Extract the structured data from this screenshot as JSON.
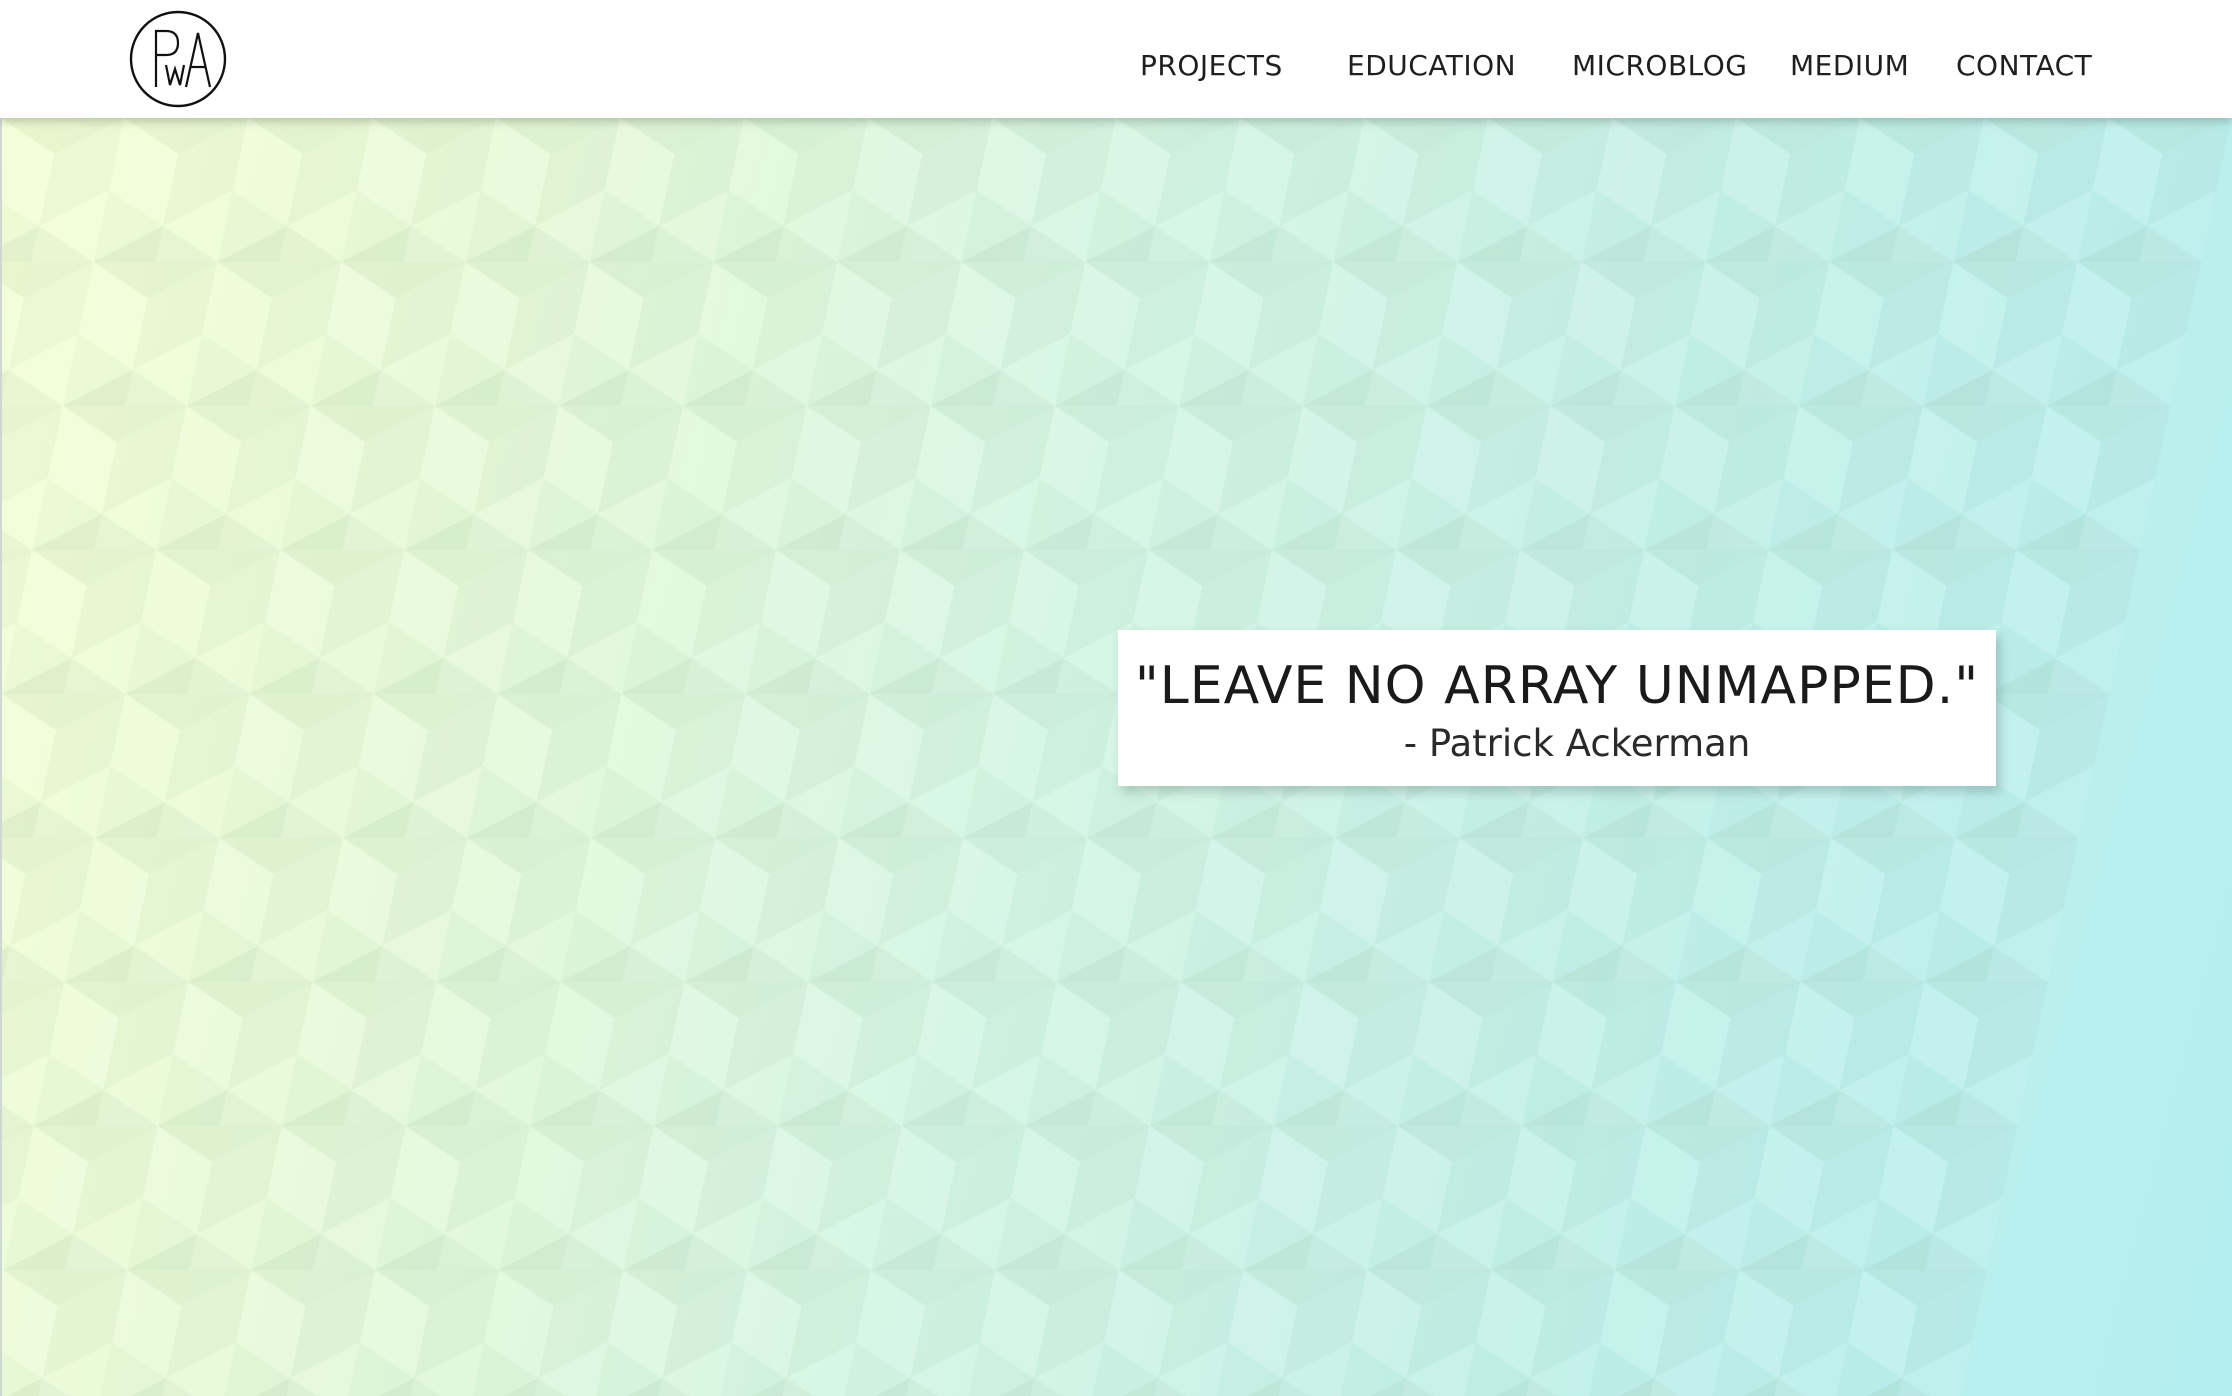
{
  "site": {
    "logo_text": "PWA"
  },
  "nav": {
    "items": [
      {
        "label": "PROJECTS"
      },
      {
        "label": "EDUCATION"
      },
      {
        "label": "MICROBLOG"
      },
      {
        "label": "MEDIUM"
      },
      {
        "label": "CONTACT"
      }
    ]
  },
  "hero": {
    "quote": "\"LEAVE NO ARRAY UNMAPPED.\"",
    "author": "- Patrick Ackerman"
  },
  "colors": {
    "header_bg": "#ffffff",
    "gradient_start": "#f4ffd6",
    "gradient_end": "#b4eef0",
    "text": "#1f1f1f"
  }
}
